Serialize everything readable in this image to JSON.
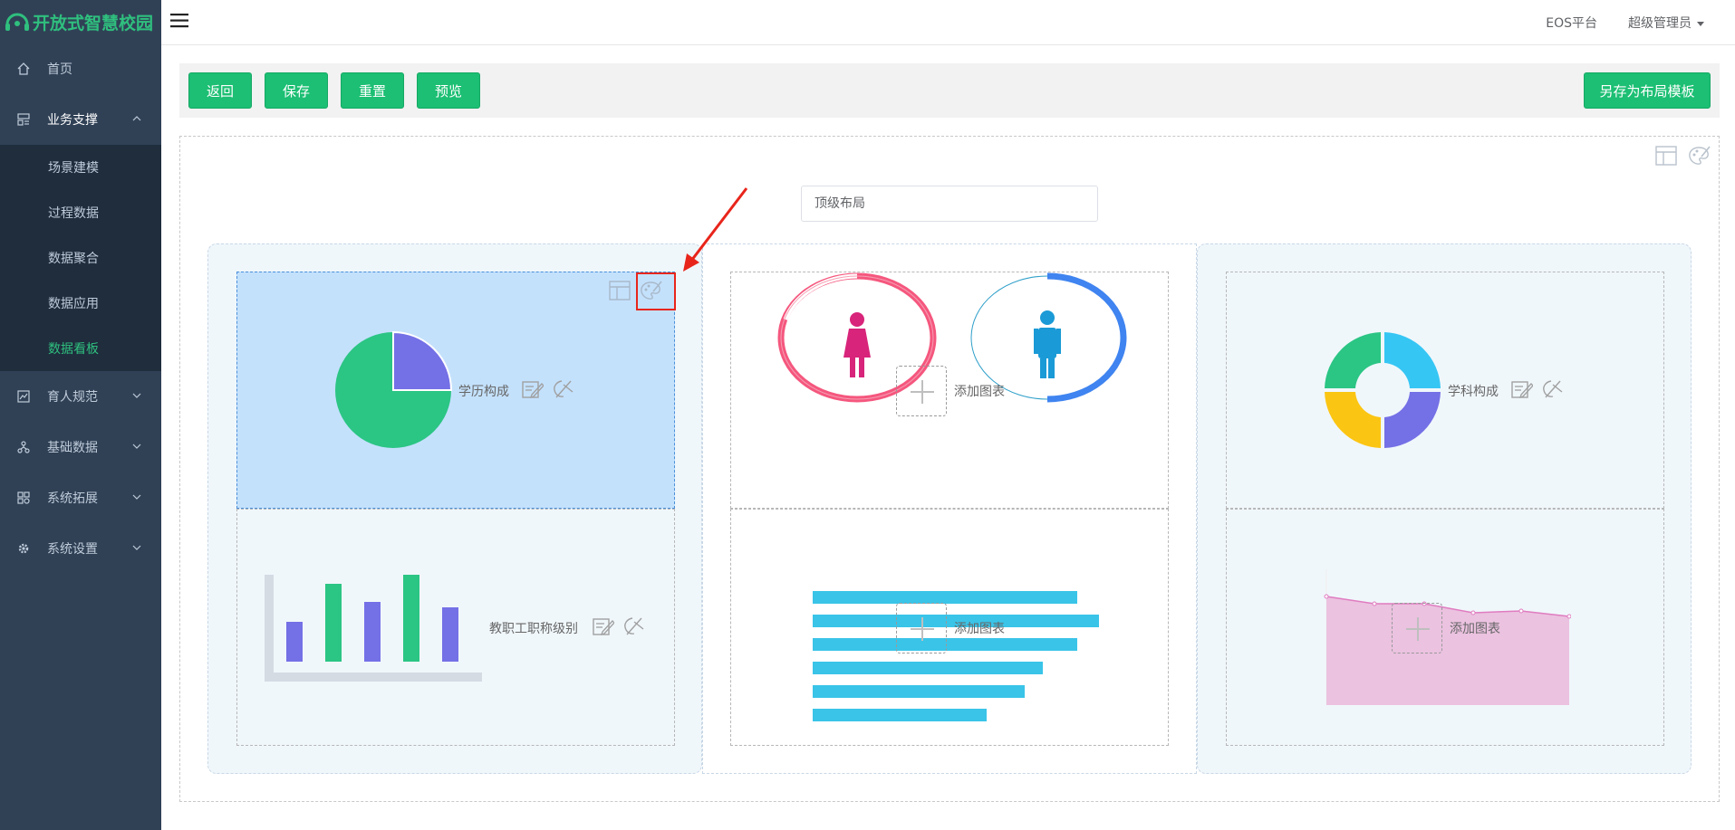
{
  "app": {
    "logo_text": "开放式智慧校园"
  },
  "sidebar": {
    "items": [
      {
        "label": "首页",
        "icon": "home-icon"
      },
      {
        "label": "业务支撑",
        "icon": "layout-icon",
        "expanded": true,
        "children": [
          "场景建模",
          "过程数据",
          "数据聚合",
          "数据应用",
          "数据看板"
        ],
        "active_child": "数据看板"
      },
      {
        "label": "育人规范",
        "icon": "chart-icon"
      },
      {
        "label": "基础数据",
        "icon": "tree-icon"
      },
      {
        "label": "系统拓展",
        "icon": "grid-icon"
      },
      {
        "label": "系统设置",
        "icon": "gear-icon"
      }
    ]
  },
  "header": {
    "platform": "EOS平台",
    "user": "超级管理员"
  },
  "toolbar": {
    "back": "返回",
    "save": "保存",
    "reset": "重置",
    "preview": "预览",
    "save_template": "另存为布局模板"
  },
  "layout": {
    "title_value": "顶级布局",
    "cells": {
      "edu": "学历构成",
      "title_level": "教职工职称级别",
      "add_chart_1": "添加图表",
      "add_chart_2": "添加图表",
      "subject": "学科构成",
      "add_chart_3": "添加图表"
    }
  },
  "colors": {
    "accent": "#1cbf73",
    "sidebar": "#304156",
    "active": "#2fbf7e",
    "highlight": "#e8251b"
  }
}
